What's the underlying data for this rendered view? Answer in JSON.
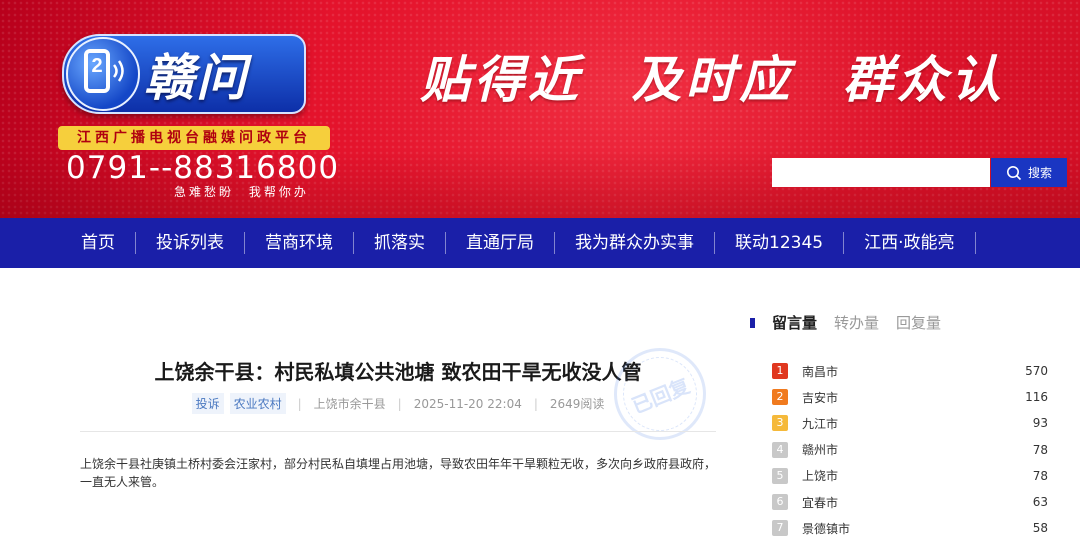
{
  "banner": {
    "logo_name": "赣问",
    "logo_digit": "2",
    "tagline": "江西广播电视台融媒问政平台",
    "hotline": "0791--88316800",
    "hotline_sub": "急难愁盼 我帮你办",
    "slogan": [
      "贴得近",
      "及时应",
      "群众认"
    ],
    "colors": {
      "red": "#e4132c",
      "blue": "#1a36c2",
      "gold": "#f6cf3c"
    }
  },
  "search": {
    "placeholder": "",
    "button_label": "搜索",
    "icon": "search-icon"
  },
  "nav": {
    "items": [
      "首页",
      "投诉列表",
      "营商环境",
      "抓落实",
      "直通厅局",
      "我为群众办实事",
      "联动12345",
      "江西·政能亮"
    ],
    "color": "#1a1fa8"
  },
  "article": {
    "title": "上饶余干县：村民私填公共池塘 致农田干旱无收没人管",
    "tags": [
      "投诉",
      "农业农村"
    ],
    "location": "上饶市余干县",
    "datetime": "2025-11-20 22:04",
    "reads": "2649阅读",
    "stamp": "已回复",
    "body": "上饶余干县社庚镇土桥村委会汪家村，部分村民私自填埋占用池塘，导致农田年年干旱颗粒无收，多次向乡政府县政府，一直无人来管。"
  },
  "ranking": {
    "tabs": [
      "留言量",
      "转办量",
      "回复量"
    ],
    "active_tab": "留言量",
    "rows": [
      {
        "rank": "1",
        "city": "南昌市",
        "count": "570",
        "color": "#e0371f"
      },
      {
        "rank": "2",
        "city": "吉安市",
        "count": "116",
        "color": "#f07a1e"
      },
      {
        "rank": "3",
        "city": "九江市",
        "count": "93",
        "color": "#f5b93a"
      },
      {
        "rank": "4",
        "city": "赣州市",
        "count": "78",
        "color": "#c8c8c8"
      },
      {
        "rank": "5",
        "city": "上饶市",
        "count": "78",
        "color": "#c8c8c8"
      },
      {
        "rank": "6",
        "city": "宜春市",
        "count": "63",
        "color": "#c8c8c8"
      },
      {
        "rank": "7",
        "city": "景德镇市",
        "count": "58",
        "color": "#c8c8c8"
      }
    ]
  }
}
